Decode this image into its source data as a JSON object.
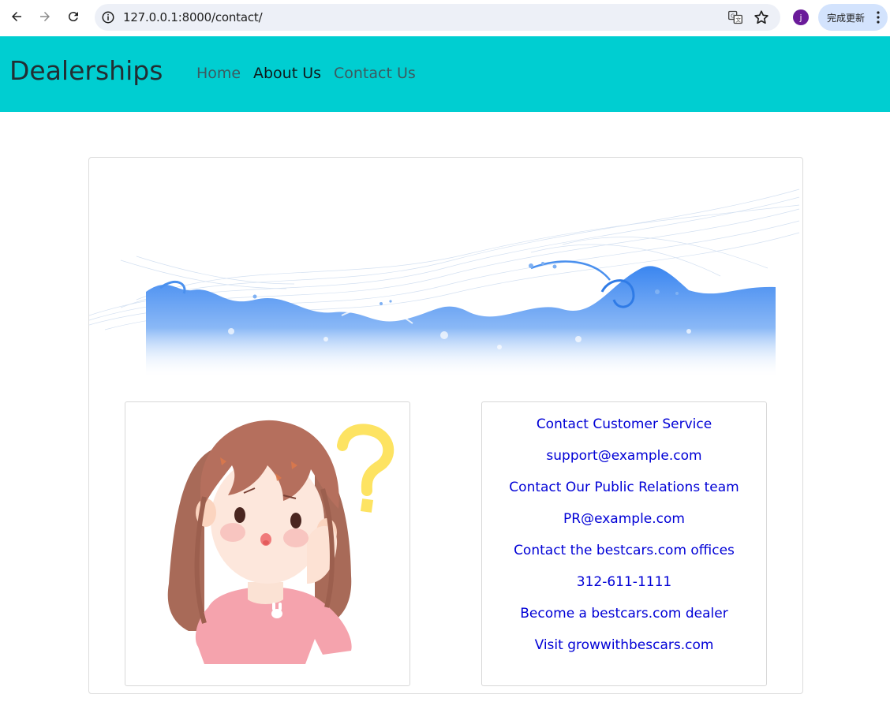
{
  "browser": {
    "url": "127.0.0.1:8000/contact/",
    "avatar_letter": "j",
    "update_label": "完成更新"
  },
  "navbar": {
    "brand": "Dealerships",
    "links": [
      {
        "label": "Home"
      },
      {
        "label": "About Us"
      },
      {
        "label": "Contact Us"
      }
    ],
    "bg_color": "#00ced1"
  },
  "contact": {
    "lines": [
      "Contact Customer Service",
      "support@example.com",
      "Contact Our Public Relations team",
      "PR@example.com",
      "Contact the bestcars.com offices",
      "312-611-1111",
      "Become a bestcars.com dealer",
      "Visit growwithbescars.com"
    ],
    "link_color": "#0000d6"
  },
  "icons": {
    "back": "arrow-left-icon",
    "forward": "arrow-right-icon",
    "reload": "reload-icon",
    "info": "info-icon",
    "translate": "translate-icon",
    "bookmark": "star-icon",
    "menu": "more-vert-icon"
  }
}
